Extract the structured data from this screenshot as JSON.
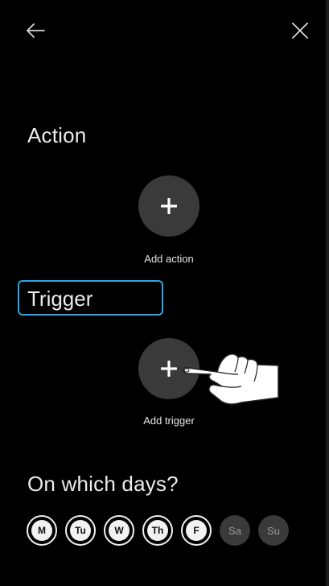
{
  "icons": {
    "back": "arrow-left-icon",
    "close": "close-icon",
    "add": "plus-icon",
    "pointer": "hand-pointer-icon"
  },
  "action": {
    "title": "Action",
    "add_label": "Add action"
  },
  "trigger": {
    "title": "Trigger",
    "add_label": "Add trigger"
  },
  "days": {
    "title": "On which days?",
    "items": [
      {
        "label": "M",
        "selected": true
      },
      {
        "label": "Tu",
        "selected": true
      },
      {
        "label": "W",
        "selected": true
      },
      {
        "label": "Th",
        "selected": true
      },
      {
        "label": "F",
        "selected": true
      },
      {
        "label": "Sa",
        "selected": false
      },
      {
        "label": "Su",
        "selected": false
      }
    ]
  },
  "colors": {
    "background": "#000000",
    "accent": "#2aa7e6",
    "circle": "#3a3a3a",
    "text": "#ececec"
  }
}
